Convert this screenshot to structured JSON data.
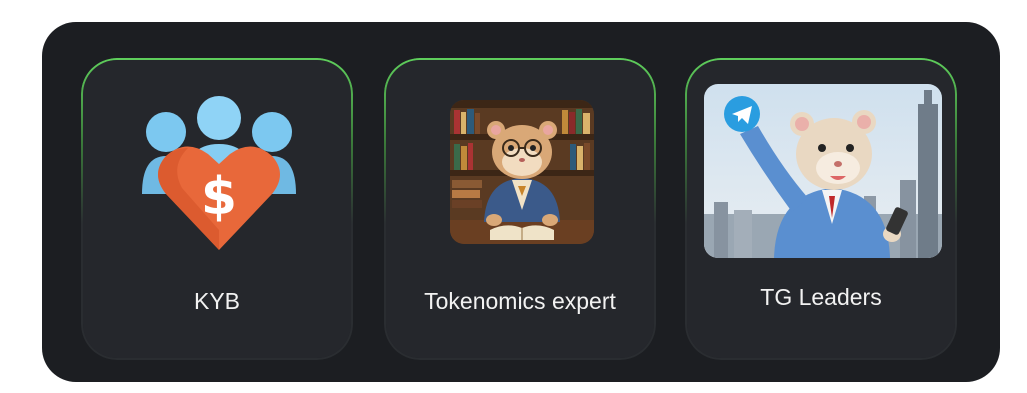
{
  "cards": [
    {
      "label": "KYB",
      "icon": "kyb-heart-dollar-icon"
    },
    {
      "label": "Tokenomics expert",
      "icon": "hamster-scholar-image"
    },
    {
      "label": "TG Leaders",
      "icon": "hamster-telegram-image"
    }
  ],
  "colors": {
    "panel": "#1c1e22",
    "card": "#25272c",
    "border_accent": "#5fcf5c",
    "text": "#f2f2f2"
  }
}
